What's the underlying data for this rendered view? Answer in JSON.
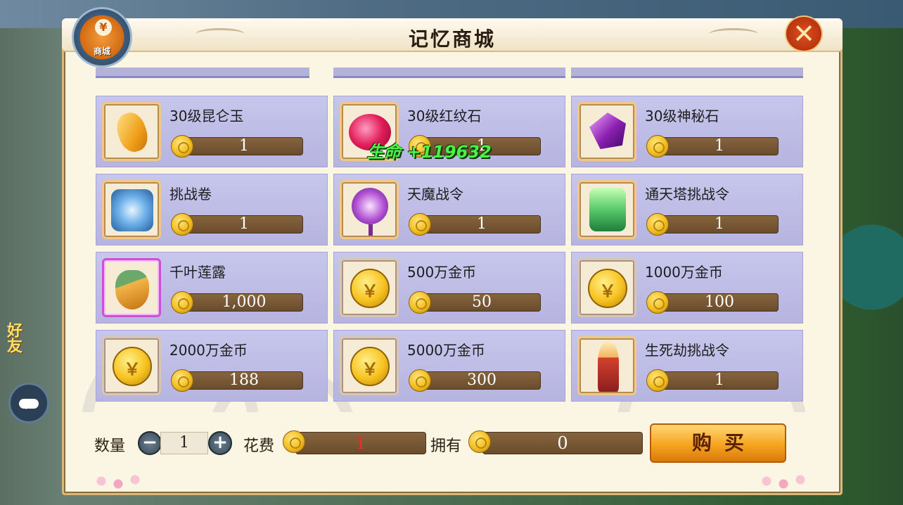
{
  "window": {
    "title": "记忆商城",
    "badge_label": "商城",
    "badge_symbol": "¥",
    "close_symbol": "✕"
  },
  "items": [
    {
      "name": "30级昆仑玉",
      "price": "1",
      "icon": "jade-icon"
    },
    {
      "name": "30级红纹石",
      "price": "1",
      "icon": "red-stone-icon"
    },
    {
      "name": "30级神秘石",
      "price": "1",
      "icon": "mystery-stone-icon"
    },
    {
      "name": "挑战卷",
      "price": "1",
      "icon": "challenge-scroll-icon"
    },
    {
      "name": "天魔战令",
      "price": "1",
      "icon": "demon-token-icon"
    },
    {
      "name": "通天塔挑战令",
      "price": "1",
      "icon": "tower-token-icon"
    },
    {
      "name": "千叶莲露",
      "price": "1,000",
      "icon": "lotus-dew-icon"
    },
    {
      "name": "500万金币",
      "price": "50",
      "icon": "gold-coin-icon"
    },
    {
      "name": "1000万金币",
      "price": "100",
      "icon": "gold-coin-icon"
    },
    {
      "name": "2000万金币",
      "price": "188",
      "icon": "gold-coin-icon"
    },
    {
      "name": "5000万金币",
      "price": "300",
      "icon": "gold-coin-icon"
    },
    {
      "name": "生死劫挑战令",
      "price": "1",
      "icon": "life-death-token-icon"
    }
  ],
  "floating_text": "生命 +119632",
  "purchase": {
    "quantity_label": "数量",
    "quantity": "1",
    "minus_symbol": "−",
    "plus_symbol": "+",
    "cost_label": "花费",
    "cost": "1",
    "owned_label": "拥有",
    "owned": "0",
    "buy_label": "购买"
  },
  "colors": {
    "cost_value": "#e8302a",
    "floating_text": "#4df048"
  }
}
